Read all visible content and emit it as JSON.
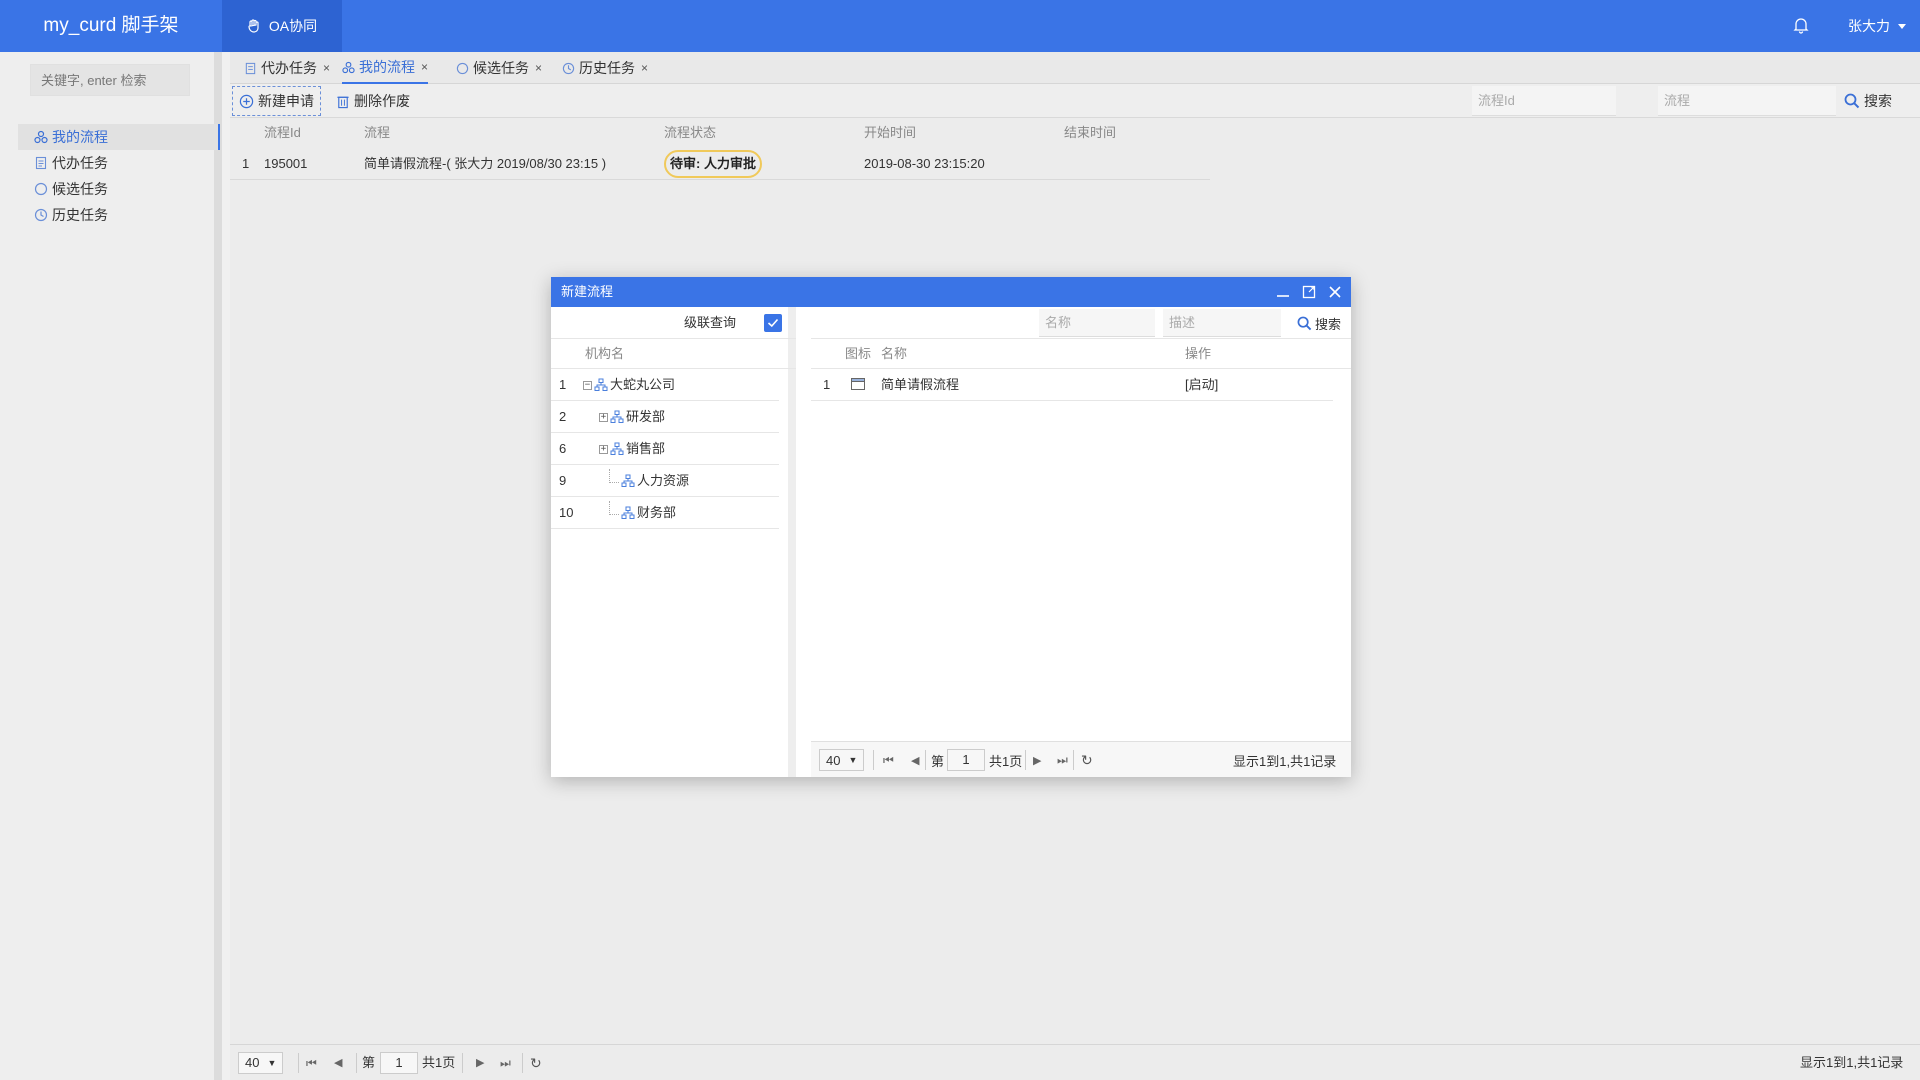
{
  "app": {
    "title": "my_curd 脚手架",
    "top_tab": "OA协同",
    "user": "张大力"
  },
  "sidebar": {
    "search_placeholder": "关键字, enter 检索",
    "items": [
      {
        "label": "我的流程",
        "icon": "flow-icon",
        "active": true
      },
      {
        "label": "代办任务",
        "icon": "document-icon"
      },
      {
        "label": "候选任务",
        "icon": "circle-icon"
      },
      {
        "label": "历史任务",
        "icon": "clock-icon"
      }
    ]
  },
  "tabs": [
    {
      "label": "代办任务"
    },
    {
      "label": "我的流程",
      "active": true
    },
    {
      "label": "候选任务"
    },
    {
      "label": "历史任务"
    }
  ],
  "toolbar": {
    "new_label": "新建申请",
    "delete_label": "删除作废",
    "field_id_placeholder": "流程Id",
    "field_flow_placeholder": "流程",
    "search_label": "搜索"
  },
  "grid": {
    "columns": [
      "流程Id",
      "流程",
      "流程状态",
      "开始时间",
      "结束时间"
    ],
    "rows": [
      {
        "num": "1",
        "id": "195001",
        "flow": "简单请假流程-( 张大力 2019/08/30 23:15 )",
        "status": "待审: 人力审批",
        "start": "2019-08-30 23:15:20",
        "end": ""
      }
    ]
  },
  "pager": {
    "size": "40",
    "page_prefix": "第",
    "page": "1",
    "page_suffix": "共1页",
    "summary": "显示1到1,共1记录"
  },
  "modal": {
    "title": "新建流程",
    "cascade_label": "级联查询",
    "org_header": "机构名",
    "tree": [
      {
        "num": "1",
        "label": "大蛇丸公司",
        "toggle": "⊟"
      },
      {
        "num": "2",
        "label": "研发部",
        "toggle": "+"
      },
      {
        "num": "6",
        "label": "销售部",
        "toggle": "+"
      },
      {
        "num": "9",
        "label": "人力资源",
        "toggle": ""
      },
      {
        "num": "10",
        "label": "财务部",
        "toggle": ""
      }
    ],
    "name_placeholder": "名称",
    "desc_placeholder": "描述",
    "search_label": "搜索",
    "columns": {
      "icon": "图标",
      "name": "名称",
      "op": "操作"
    },
    "rows": [
      {
        "num": "1",
        "name": "简单请假流程",
        "op": "[启动]"
      }
    ],
    "pager": {
      "size": "40",
      "page_prefix": "第",
      "page": "1",
      "page_suffix": "共1页",
      "summary": "显示1到1,共1记录"
    }
  },
  "colors": {
    "primary": "#3a74e6",
    "status_border": "#f0c95a"
  }
}
